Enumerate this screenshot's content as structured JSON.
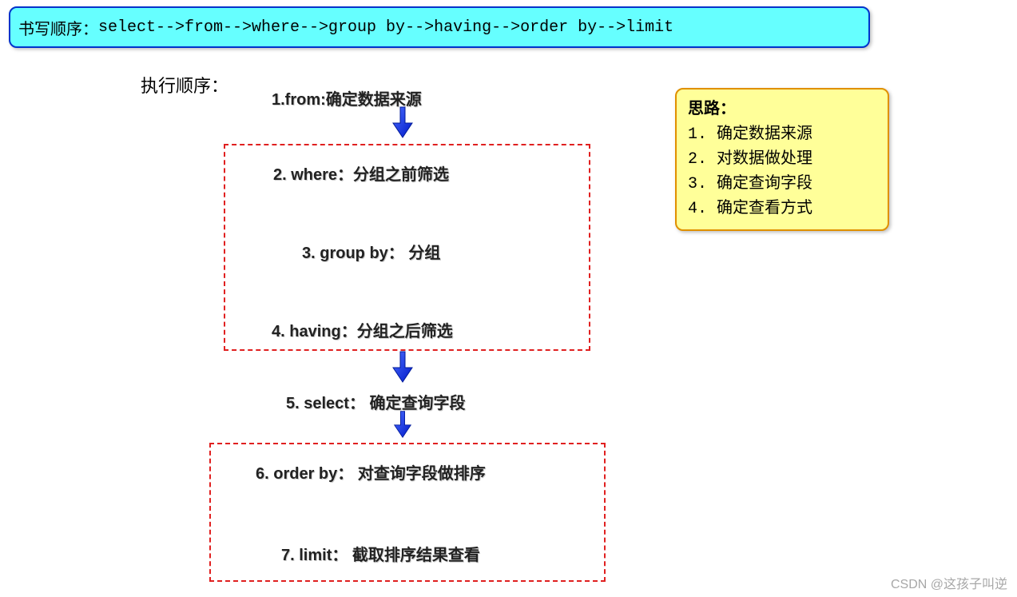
{
  "banner": {
    "prefix": "书写顺序：",
    "sequence": "select-->from-->where-->group by-->having-->order by-->limit"
  },
  "exec_label": "执行顺序：",
  "steps": {
    "s1": "1.from:确定数据来源",
    "s2": "2. where：分组之前筛选",
    "s3": "3. group by： 分组",
    "s4": "4. having：分组之后筛选",
    "s5": "5. select： 确定查询字段",
    "s6": "6. order by： 对查询字段做排序",
    "s7": "7. limit： 截取排序结果查看"
  },
  "tips": {
    "title": "思路：",
    "items": [
      "1.  确定数据来源",
      "2.  对数据做处理",
      "3.  确定查询字段",
      "4.  确定查看方式"
    ]
  },
  "watermark": "CSDN @这孩子叫逆"
}
